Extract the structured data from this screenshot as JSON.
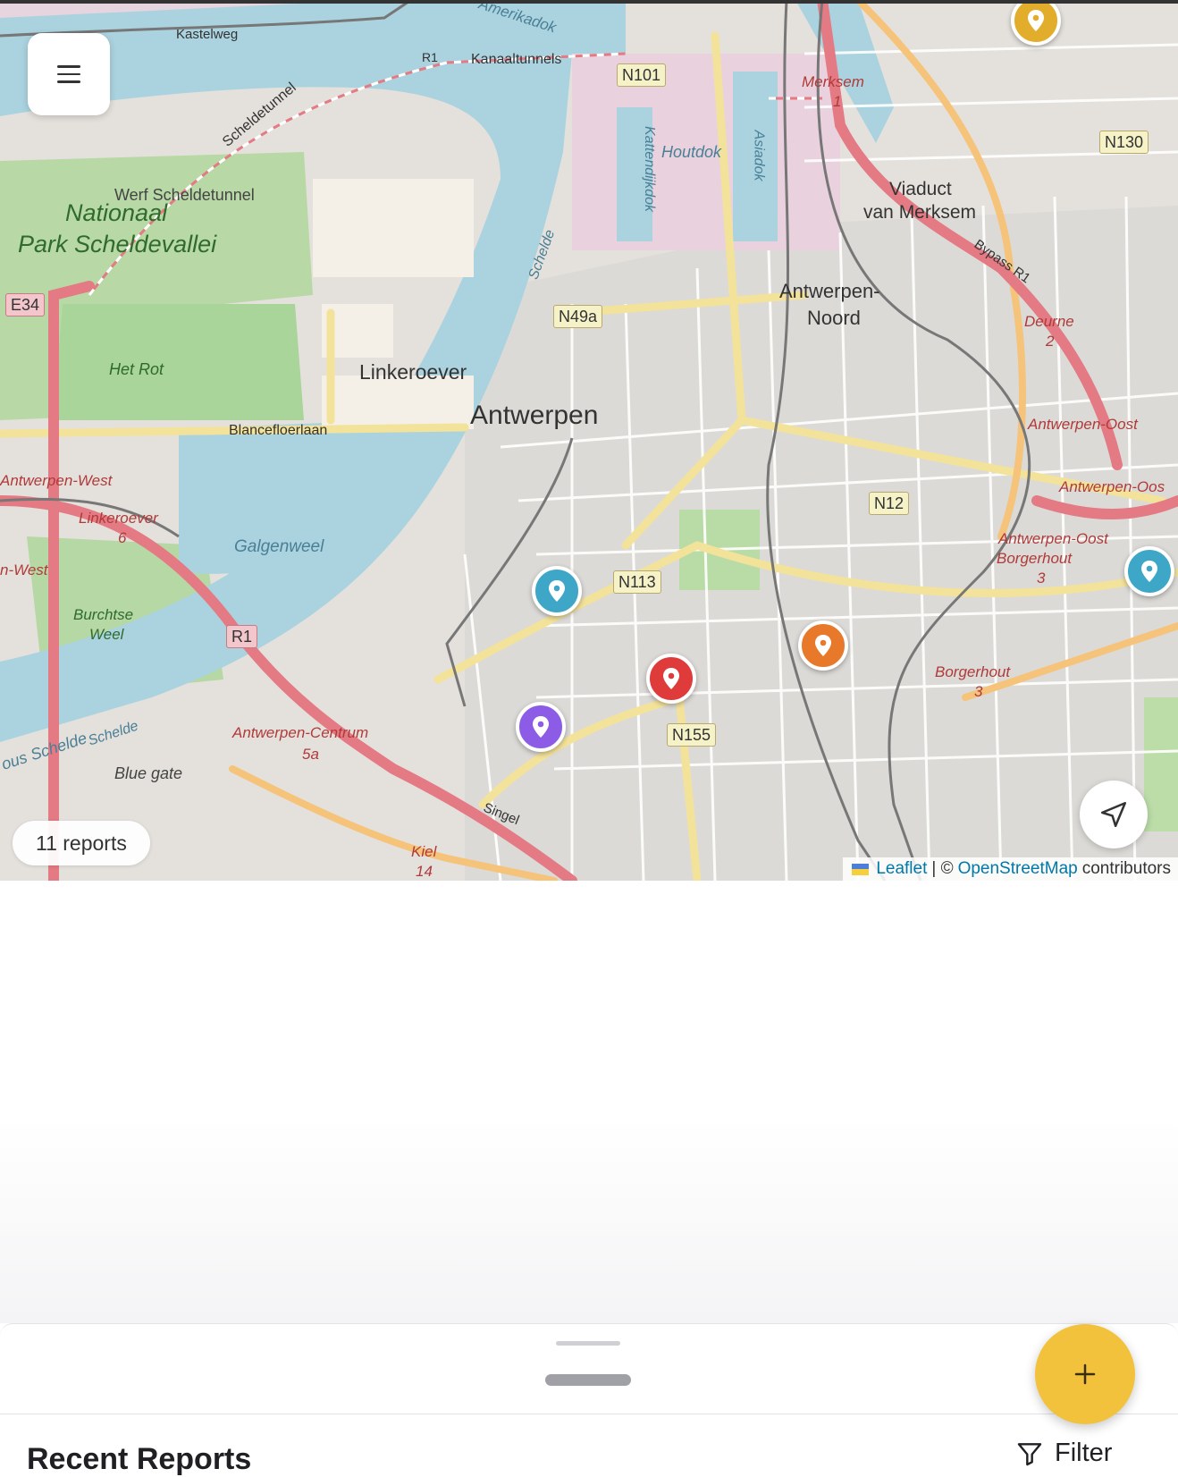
{
  "map": {
    "report_count": "11 reports",
    "attribution": {
      "leaflet": "Leaflet",
      "separator": "| ©",
      "osm": "OpenStreetMap",
      "suffix": "contributors"
    },
    "place_labels": {
      "antwerpen": "Antwerpen",
      "linkeroever": "Linkeroever",
      "nationaal_1": "Nationaal",
      "nationaal_2": "Park Scheldevallei",
      "werf": "Werf Scheldetunnel",
      "het_rot": "Het Rot",
      "blancefloerlaan": "Blancefloerlaan",
      "galgenweel": "Galgenweel",
      "burchtse_1": "Burchtse",
      "burchtse_2": "Weel",
      "blue_gate": "Blue gate",
      "viaduct_1": "Viaduct",
      "viaduct_2": "van Merksem",
      "noord_1": "Antwerpen-",
      "noord_2": "Noord",
      "houtdok": "Houtdok",
      "kastelweg": "Kastelweg",
      "amerikadok": "Amerikadok",
      "kanaaltunnels": "Kanaaltunnels",
      "kattendijkdok": "Kattendijkdok",
      "asiadok": "Asiadok",
      "scheldetunnel": "Scheldetunnel",
      "schelde": "Schelde",
      "schelde_2": "Schelde",
      "merksem": "Merksem",
      "deurne": "Deurne",
      "bypass": "Bypass R1",
      "antwerpen_west": "Antwerpen-West",
      "n_west": "n-West",
      "linkeroever_6": "Linkeroever",
      "antwerpen_centrum": "Antwerpen-Centrum",
      "antwerpen_oost": "Antwerpen-Oost",
      "antwerpen_oos": "Antwerpen-Oos",
      "oost_borgerhout_1": "Antwerpen-Oost",
      "oost_borgerhout_2": "Borgerhout",
      "borgerhout": "Borgerhout",
      "singel": "Singel",
      "kiel": "Kiel",
      "ous_schelde": "ous Schelde",
      "r1_top": "R1"
    },
    "exit_numbers": {
      "merksem": "1",
      "deurne": "2",
      "linkeroever": "6",
      "centrum": "5a",
      "borgerhout": "3",
      "oost": "3",
      "kiel": "14"
    },
    "road_shields": {
      "n101": "N101",
      "n130": "N130",
      "e34": "E34",
      "n49a": "N49a",
      "n12": "N12",
      "n113": "N113",
      "n155": "N155",
      "r1": "R1"
    },
    "markers": [
      {
        "color": "#3ea7c7"
      },
      {
        "color": "#e03b3b"
      },
      {
        "color": "#e8782a"
      },
      {
        "color": "#8d5ce6"
      },
      {
        "color": "#3ea7c7"
      },
      {
        "color": "#e2ad2b"
      }
    ]
  },
  "sheet": {
    "title": "Recent Reports",
    "filter_label": "Filter"
  },
  "icons": {
    "menu": "menu-icon",
    "locate": "navigation-arrow-icon",
    "filter": "filter-funnel-icon",
    "add": "plus-icon",
    "marker": "map-pin-icon"
  },
  "colors": {
    "accent": "#f2c23d",
    "link": "#0078a8"
  }
}
